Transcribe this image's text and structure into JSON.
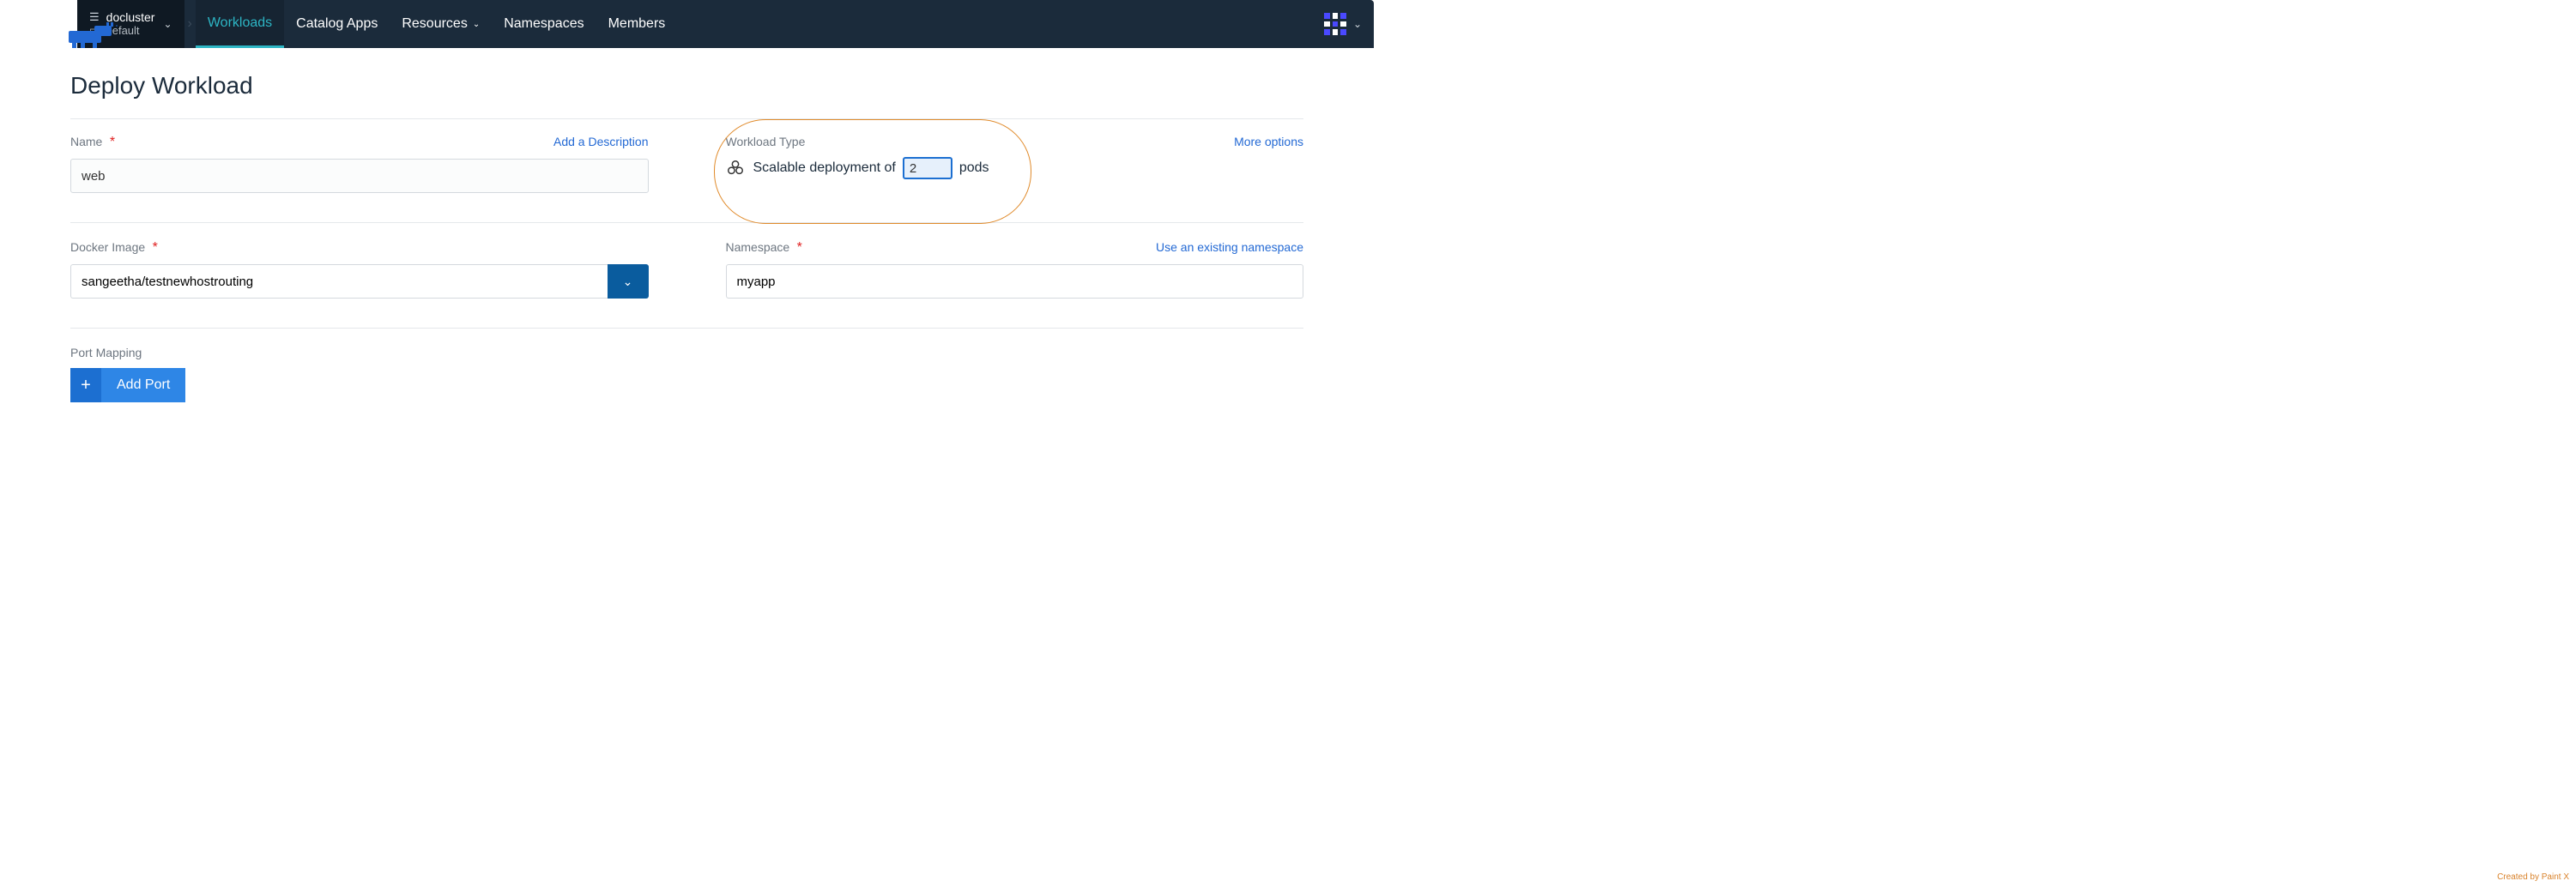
{
  "nav": {
    "cluster": "docluster",
    "project": "Default",
    "items": [
      "Workloads",
      "Catalog Apps",
      "Resources",
      "Namespaces",
      "Members"
    ],
    "active_index": 0,
    "resources_has_caret": true
  },
  "page": {
    "title": "Deploy Workload"
  },
  "name_section": {
    "label": "Name",
    "add_description": "Add a Description",
    "value": "web"
  },
  "workload_type": {
    "label": "Workload Type",
    "more_options": "More options",
    "prefix": "Scalable deployment of",
    "count": "2",
    "suffix": "pods"
  },
  "docker_image": {
    "label": "Docker Image",
    "value": "sangeetha/testnewhostrouting"
  },
  "namespace": {
    "label": "Namespace",
    "use_existing": "Use an existing namespace",
    "value": "myapp"
  },
  "port_mapping": {
    "label": "Port Mapping",
    "add_port": "Add Port"
  },
  "watermark": "Created by Paint X"
}
